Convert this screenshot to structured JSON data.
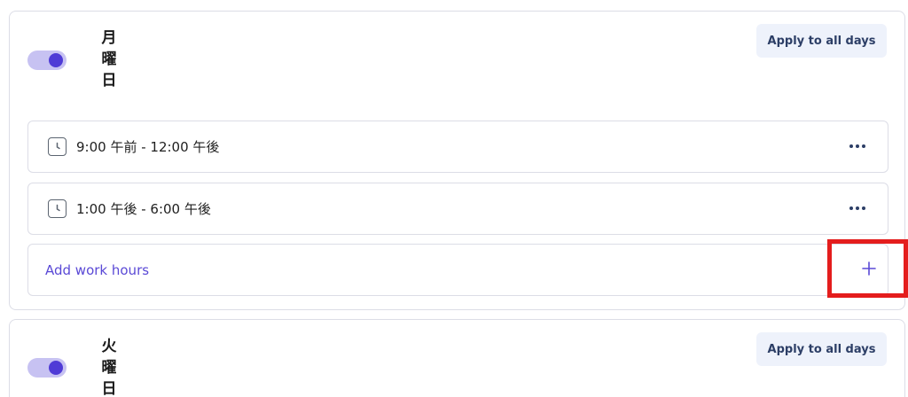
{
  "days": [
    {
      "name": "月曜日",
      "enabled": true,
      "apply_label": "Apply to all days",
      "ranges": [
        {
          "text": "9:00 午前 - 12:00 午後"
        },
        {
          "text": "1:00 午後 - 6:00 午後"
        }
      ],
      "add_label": "Add work hours"
    },
    {
      "name": "火曜日",
      "enabled": true,
      "apply_label": "Apply to all days"
    }
  ],
  "colors": {
    "accent": "#4f3bd6",
    "toggle_track": "#c7c2f2",
    "link": "#5a49d6",
    "highlight": "#e41d1d",
    "button_bg": "#eef2fb"
  }
}
